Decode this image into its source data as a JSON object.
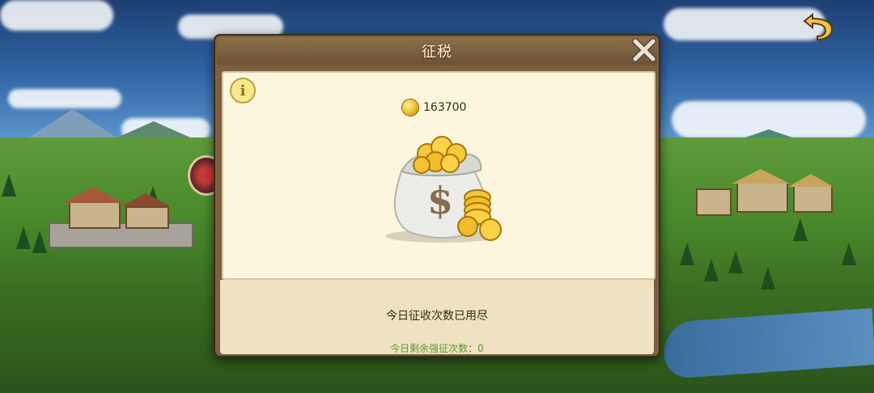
{
  "dialog": {
    "title": "征税",
    "gold_amount": "163700",
    "status_message": "今日征收次数已用尽",
    "force_collect_text": "今日剩余强征次数：0"
  },
  "icons": {
    "back": "back-arrow-icon",
    "close": "close-icon",
    "info": "info-icon",
    "currency": "gold-coin-icon",
    "illustration": "money-bag-icon"
  },
  "colors": {
    "dialog_frame": "#7a6040",
    "panel_bg": "#fdf6df",
    "force_text": "#5c9a2e",
    "gold": "#f3c63a"
  }
}
